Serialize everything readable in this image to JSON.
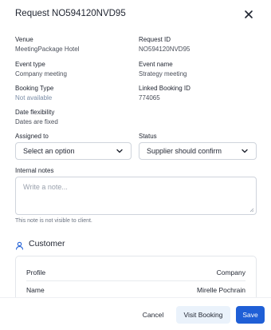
{
  "header": {
    "title": "Request NO594120NVD95"
  },
  "details": {
    "venue_label": "Venue",
    "venue_value": "MeetingPackage Hotel",
    "request_id_label": "Request ID",
    "request_id_value": "NO594120NVD95",
    "event_type_label": "Event type",
    "event_type_value": "Company meeting",
    "event_name_label": "Event name",
    "event_name_value": "Strategy meeting",
    "booking_type_label": "Booking Type",
    "booking_type_value": "Not available",
    "linked_booking_label": "Linked Booking ID",
    "linked_booking_value": "774065",
    "date_flex_label": "Date flexibility",
    "date_flex_value": "Dates are fixed"
  },
  "assigned": {
    "label": "Assigned to",
    "value": "Select an option"
  },
  "status": {
    "label": "Status",
    "value": "Supplier should confirm"
  },
  "notes": {
    "label": "Internal notes",
    "placeholder": "Write a note...",
    "hint": "This note is not visible to client."
  },
  "customer": {
    "title": "Customer",
    "rows": [
      {
        "key": "Profile",
        "value": "Company"
      },
      {
        "key": "Name",
        "value": "Mirelle Pochrain"
      }
    ]
  },
  "footer": {
    "cancel_label": "Cancel",
    "visit_label": "Visit Booking",
    "save_label": "Save"
  },
  "colors": {
    "primary": "#1f5fd6",
    "secondary_bg": "#eaf2fb",
    "muted_value": "#7b8da6"
  },
  "icons": {
    "close": "close-icon",
    "chevron": "chevron-down-icon",
    "customer": "user-icon"
  }
}
